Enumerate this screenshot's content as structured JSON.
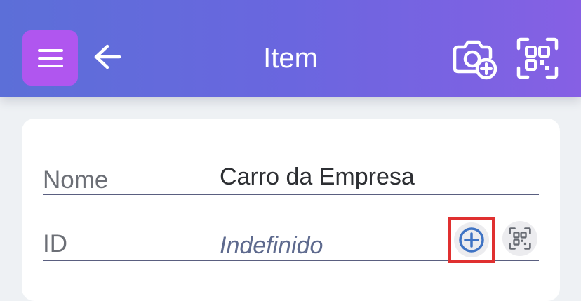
{
  "header": {
    "title": "Item",
    "menu_icon": "hamburger-menu-icon",
    "back_icon": "arrow-left-icon",
    "camera_icon": "camera-add-icon",
    "qr_icon": "qr-scan-icon"
  },
  "form": {
    "fields": [
      {
        "label": "Nome",
        "value": "Carro da Empresa"
      },
      {
        "label": "ID",
        "value": "Indefinido"
      }
    ],
    "id_actions": {
      "add_icon": "plus-circle-icon",
      "scan_icon": "qr-scan-icon"
    }
  },
  "colors": {
    "header_start": "#5c6fd8",
    "header_end": "#8660e4",
    "menu_button": "#b056ef",
    "add_icon": "#3f73c4",
    "highlight_border": "#e03030"
  }
}
